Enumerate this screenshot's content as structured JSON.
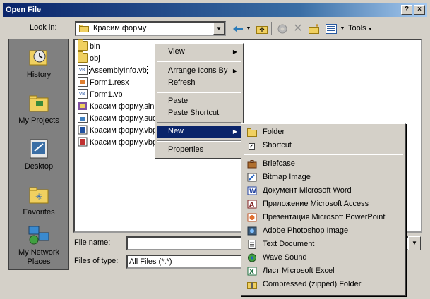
{
  "window": {
    "title": "Open File",
    "help_button": "?",
    "close_button": "×"
  },
  "lookin": {
    "label": "Look in:",
    "value": "Красим форму"
  },
  "toolbar": {
    "tools_label": "Tools"
  },
  "places": [
    {
      "label": "History",
      "icon": "history-icon"
    },
    {
      "label": "My Projects",
      "icon": "my-projects-icon"
    },
    {
      "label": "Desktop",
      "icon": "desktop-icon"
    },
    {
      "label": "Favorites",
      "icon": "favorites-icon"
    },
    {
      "label": "My Network Places",
      "icon": "network-places-icon"
    }
  ],
  "files": [
    {
      "name": "bin",
      "type": "folder"
    },
    {
      "name": "obj",
      "type": "folder"
    },
    {
      "name": "AssemblyInfo.vb",
      "type": "vb"
    },
    {
      "name": "Form1.resx",
      "type": "resx"
    },
    {
      "name": "Form1.vb",
      "type": "vb"
    },
    {
      "name": "Красим форму.sln",
      "type": "sln"
    },
    {
      "name": "Красим форму.suo",
      "type": "suo"
    },
    {
      "name": "Красим форму.vbpr",
      "type": "vbproj"
    },
    {
      "name": "Красим форму.vbpr",
      "type": "vbproj"
    }
  ],
  "bottom": {
    "filename_label": "File name:",
    "filename_value": "",
    "filetype_label": "Files of type:",
    "filetype_value": "All Files (*.*)"
  },
  "context_menu": {
    "view": "View",
    "arrange": "Arrange Icons By",
    "refresh": "Refresh",
    "paste": "Paste",
    "paste_shortcut": "Paste Shortcut",
    "new": "New",
    "properties": "Properties"
  },
  "new_submenu": [
    {
      "label": "Folder",
      "icon": "folder-icon"
    },
    {
      "label": "Shortcut",
      "icon": "shortcut-icon"
    },
    {
      "label": "Briefcase",
      "icon": "briefcase-icon"
    },
    {
      "label": "Bitmap Image",
      "icon": "bitmap-icon"
    },
    {
      "label": "Документ Microsoft Word",
      "icon": "word-icon"
    },
    {
      "label": "Приложение Microsoft Access",
      "icon": "access-icon"
    },
    {
      "label": "Презентация Microsoft PowerPoint",
      "icon": "powerpoint-icon"
    },
    {
      "label": "Adobe Photoshop Image",
      "icon": "photoshop-icon"
    },
    {
      "label": "Text Document",
      "icon": "text-document-icon"
    },
    {
      "label": "Wave Sound",
      "icon": "wave-sound-icon"
    },
    {
      "label": "Лист Microsoft Excel",
      "icon": "excel-icon"
    },
    {
      "label": "Compressed (zipped) Folder",
      "icon": "zip-folder-icon"
    }
  ],
  "colors": {
    "title_start": "#0a246a",
    "title_end": "#a6caf0",
    "selection": "#0a246a",
    "face": "#d4d0c8"
  }
}
